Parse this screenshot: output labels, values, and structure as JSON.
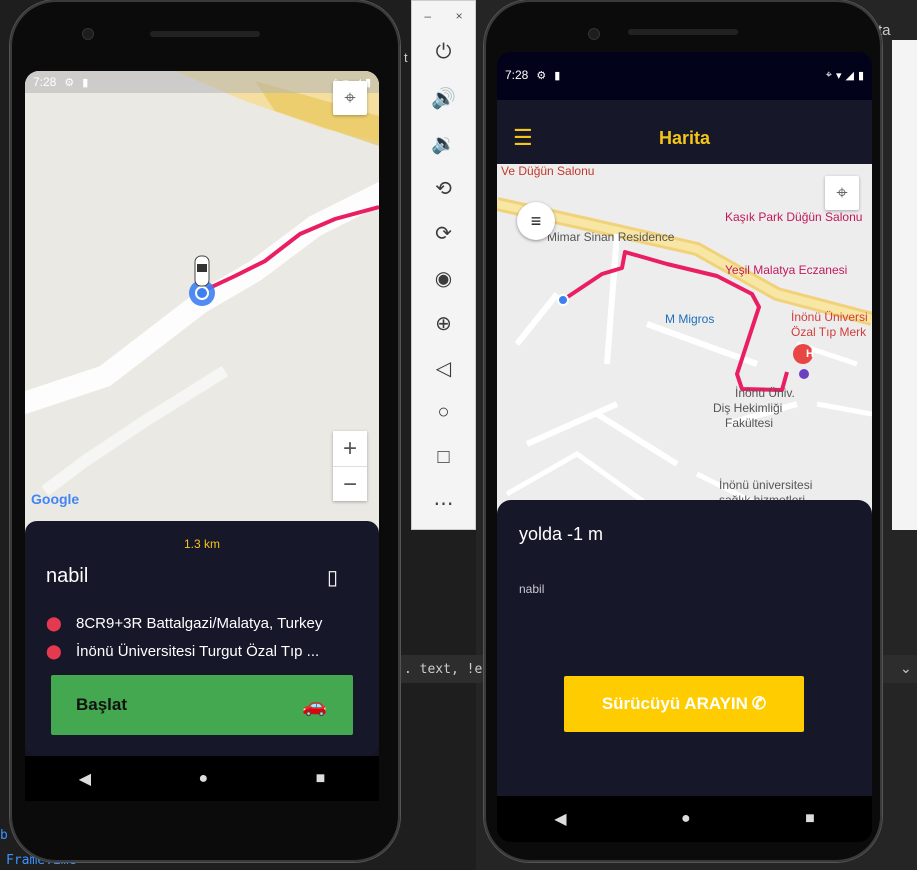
{
  "left_phone": {
    "status": {
      "time": "7:28"
    },
    "map": {
      "attribution": "Google",
      "zoom_in": "+",
      "zoom_out": "−"
    },
    "sheet": {
      "distance": "1.3 km",
      "passenger_name": "nabil",
      "pickup_address": "8CR9+3R Battalgazi/Malatya, Turkey",
      "dropoff_address": "İnönü Üniversitesi Turgut Özal Tıp ...",
      "start_button": "Başlat"
    }
  },
  "right_phone": {
    "status": {
      "time": "7:28"
    },
    "app_title": "Harita",
    "map_labels": {
      "salon": "Ve Düğün Salonu",
      "park": "Kaşık Park Düğün Salonu",
      "residence": "Mimar Sinan Residence",
      "pharmacy": "Yeşil Malatya Eczanesi",
      "migros": "M Migros",
      "hospital_1": "İnönü Üniversi",
      "hospital_2": "Özal Tıp Merk",
      "dent_1": "İnönü Üniv.",
      "dent_2": "Diş Hekimliği",
      "dent_3": "Fakültesi",
      "uni_1": "İnönü üniversitesi",
      "uni_2": "sağlık hizmetleri",
      "hospital_marker": "H"
    },
    "sheet": {
      "status_text": "yolda -1 m",
      "rider_name": "nabil",
      "call_button": "Sürücüyü ARAYIN"
    }
  },
  "ide": {
    "row_text": ". text, !exclu",
    "bottom_text": "FrameTime",
    "left_char": "b",
    "top_right": "ta",
    "top_mid": "t"
  },
  "colors": {
    "accent_yellow": "#f5c518",
    "route": "#e91e63",
    "start_green": "#43a84f",
    "sheet_bg": "#161729"
  }
}
